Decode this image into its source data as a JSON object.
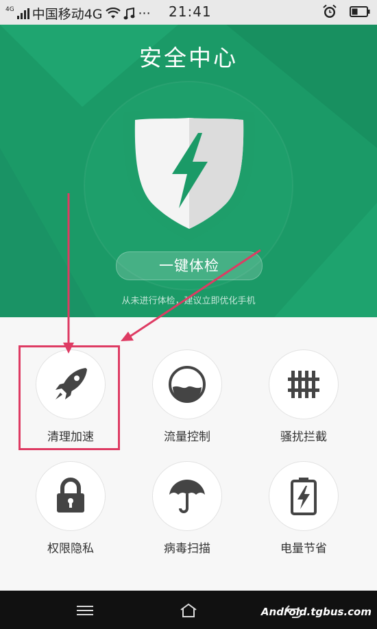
{
  "status_bar": {
    "network_small": "4G",
    "carrier": "中国移动4G",
    "more": "···",
    "time": "21:41"
  },
  "header": {
    "title": "安全中心",
    "check_button": "一键体检",
    "hint": "从未进行体检，建议立即优化手机"
  },
  "grid": [
    {
      "label": "清理加速",
      "icon": "rocket-icon"
    },
    {
      "label": "流量控制",
      "icon": "data-gauge-icon"
    },
    {
      "label": "骚扰拦截",
      "icon": "fence-icon"
    },
    {
      "label": "权限隐私",
      "icon": "lock-icon"
    },
    {
      "label": "病毒扫描",
      "icon": "umbrella-icon"
    },
    {
      "label": "电量节省",
      "icon": "battery-icon"
    }
  ],
  "watermark": "Android.tgbus.com",
  "colors": {
    "header_green": "#1b9a67",
    "annotation_pink": "#de3b63",
    "icon_gray": "#444444"
  }
}
